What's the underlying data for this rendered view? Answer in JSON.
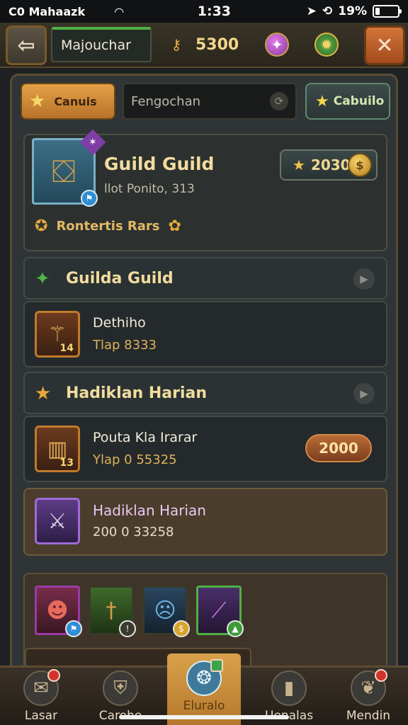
{
  "status": {
    "carrier": "C0 Mahaazk",
    "time": "1:33",
    "battery": "19%",
    "battery_level": 0.19,
    "wifi_icon": "wifi-icon",
    "location_icon": "location-arrow-icon"
  },
  "topbar": {
    "back_icon": "back-arrow-icon",
    "player_name": "Majouchar",
    "gold_amount": "5300",
    "close_icon": "close-icon"
  },
  "tabs": {
    "left_label": "Canuis",
    "search_value": "Fengochan",
    "right_label": "Cabuilo"
  },
  "guild": {
    "name": "Guild Guild",
    "subtitle": "llot Ponito, 313",
    "gold": "2030",
    "bonus_label": "Rontertis Rars"
  },
  "sections": [
    {
      "title": "Guilda Guild"
    },
    {
      "title": "Hadiklan Harian"
    }
  ],
  "items": [
    {
      "title": "Dethiho",
      "sub": "Tlap 8333",
      "level": "14"
    },
    {
      "title": "Pouta Kla Irarar",
      "sub": "Ylap 0 55325",
      "level": "13",
      "price": "2000"
    }
  ],
  "hero": {
    "title": "Hadiklan Harian",
    "sub": "200 0 33258"
  },
  "nav": [
    {
      "label": "Lasar"
    },
    {
      "label": "Carohe"
    },
    {
      "label": "Eluralo"
    },
    {
      "label": "Uenalas"
    },
    {
      "label": "Mendin"
    }
  ],
  "colors": {
    "accent_gold": "#e4a247",
    "frame": "#5a4c30",
    "active_tab": "#d9a24a",
    "price_button": "#b96c37"
  }
}
